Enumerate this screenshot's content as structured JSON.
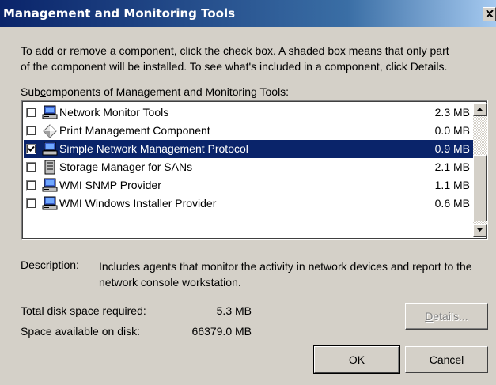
{
  "window": {
    "title": "Management and Monitoring Tools",
    "close_icon": "close-icon"
  },
  "intro_text": "To add or remove a component, click the check box. A shaded box means that only part\nof the component will be installed. To see what's included in a component, click Details.",
  "subcomponents": {
    "label_prefix": "Sub",
    "label_mnemonic": "c",
    "label_rest": "omponents of Management and Monitoring Tools:",
    "items": [
      {
        "label": "Network Monitor Tools",
        "size": "2.3 MB",
        "checked": false,
        "selected": false,
        "icon": "computer-icon"
      },
      {
        "label": "Print Management Component",
        "size": "0.0 MB",
        "checked": false,
        "selected": false,
        "icon": "diamond-icon"
      },
      {
        "label": "Simple Network Management Protocol",
        "size": "0.9 MB",
        "checked": true,
        "selected": true,
        "icon": "computer-icon"
      },
      {
        "label": "Storage Manager for SANs",
        "size": "2.1 MB",
        "checked": false,
        "selected": false,
        "icon": "server-icon"
      },
      {
        "label": "WMI SNMP Provider",
        "size": "1.1 MB",
        "checked": false,
        "selected": false,
        "icon": "computer-icon"
      },
      {
        "label": "WMI Windows Installer Provider",
        "size": "0.6 MB",
        "checked": false,
        "selected": false,
        "icon": "computer-icon"
      }
    ]
  },
  "description": {
    "label": "Description:",
    "text": "Includes agents that monitor the activity in network devices and report to the network console workstation."
  },
  "disk": {
    "required_label": "Total disk space required:",
    "required_value": "5.3 MB",
    "available_label": "Space available on disk:",
    "available_value": "66379.0 MB"
  },
  "buttons": {
    "details_mnemonic": "D",
    "details_rest": "etails...",
    "ok": "OK",
    "cancel": "Cancel"
  },
  "colors": {
    "selection": "#0a246a",
    "dialog_bg": "#d4d0c8"
  }
}
